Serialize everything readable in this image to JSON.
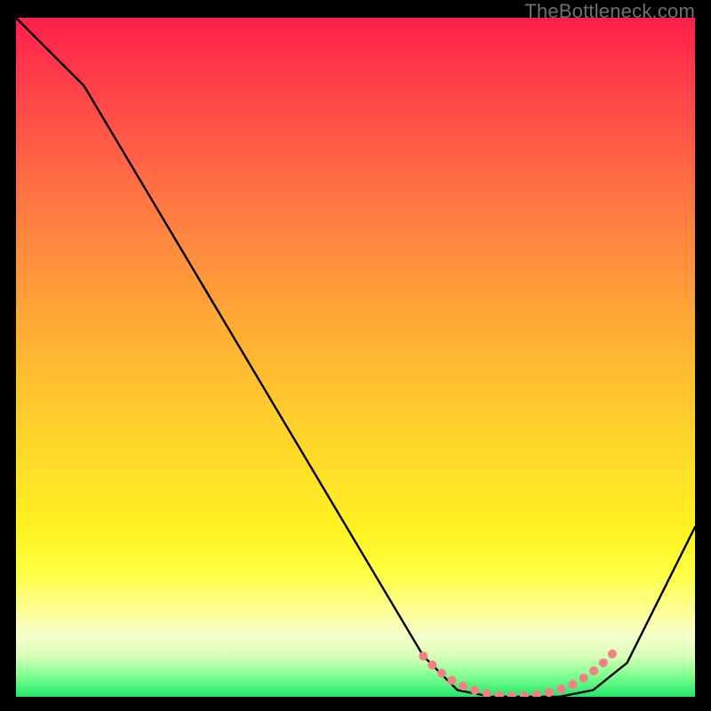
{
  "watermark": "TheBottleneck.com",
  "chart_data": {
    "type": "line",
    "title": "",
    "xlabel": "",
    "ylabel": "",
    "xlim": [
      0,
      100
    ],
    "ylim": [
      0,
      100
    ],
    "grid": false,
    "legend": false,
    "series": [
      {
        "name": "curve",
        "x": [
          0,
          10,
          60,
          65,
          70,
          75,
          80,
          85,
          90,
          100
        ],
        "y": [
          100,
          90,
          6,
          1,
          0,
          0,
          0,
          1,
          5,
          25
        ]
      }
    ],
    "markers": {
      "name": "highlight-band",
      "color": "#f57f84",
      "x": [
        60,
        62,
        64,
        66,
        68,
        70,
        72,
        74,
        76,
        78,
        80,
        82,
        84,
        86,
        88
      ],
      "y": [
        6,
        4,
        2.5,
        1.5,
        0.8,
        0.3,
        0.1,
        0.1,
        0.2,
        0.5,
        1.0,
        1.8,
        3.0,
        4.5,
        6.5
      ]
    }
  }
}
